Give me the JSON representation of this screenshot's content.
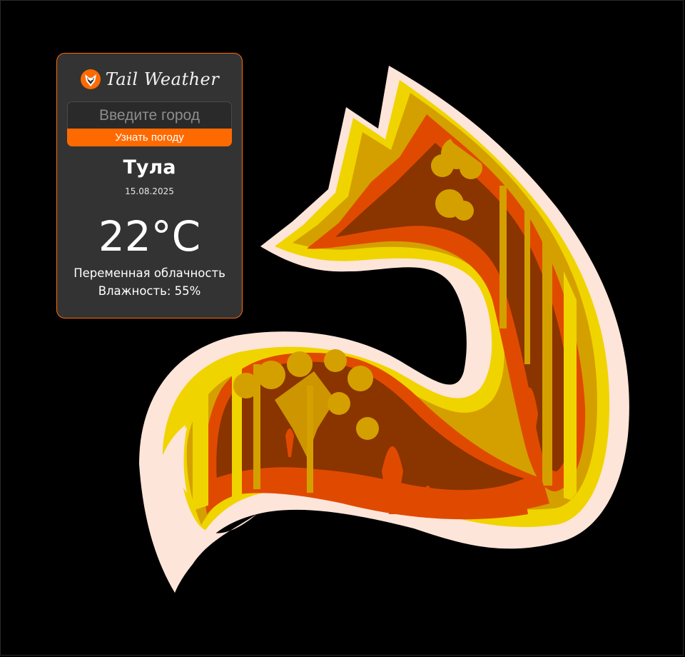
{
  "app": {
    "brand_name": "Tail Weather"
  },
  "search": {
    "placeholder": "Введите город",
    "value": "",
    "button_label": "Узнать погоду"
  },
  "weather": {
    "city": "Тула",
    "date": "15.08.2025",
    "temperature": "22°C",
    "condition": "Переменная облачность",
    "humidity": "Влажность: 55%"
  },
  "colors": {
    "accent": "#ff6a00",
    "card_background": "#333333",
    "page_background": "#000000",
    "fox_yellow": "#f0d400",
    "fox_gold": "#d4a000",
    "fox_orange": "#e04a00",
    "fox_brown": "#8a3400",
    "fox_outline": "#fde5da"
  },
  "icons": {
    "brand_logo": "fox-logo-icon",
    "artwork": "fox-forest-illustration"
  }
}
